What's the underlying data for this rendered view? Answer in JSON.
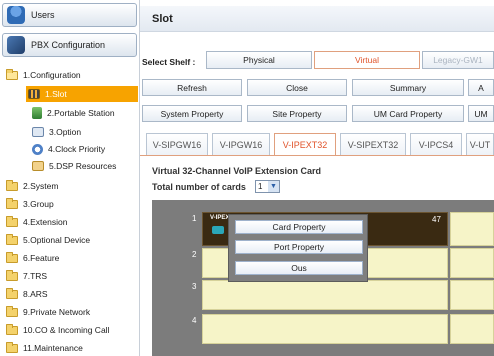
{
  "sidebar": {
    "users_label": "Users",
    "pbx_label": "PBX Configuration",
    "tree": [
      {
        "label": "1.Configuration",
        "icon": "folder-open-icon"
      },
      {
        "label": "1.Slot",
        "icon": "slot-icon",
        "selected": true
      },
      {
        "label": "2.Portable Station",
        "icon": "portable-station-icon"
      },
      {
        "label": "3.Option",
        "icon": "option-icon"
      },
      {
        "label": "4.Clock Priority",
        "icon": "clock-icon"
      },
      {
        "label": "5.DSP Resources",
        "icon": "dsp-icon"
      },
      {
        "label": "2.System",
        "icon": "folder-icon"
      },
      {
        "label": "3.Group",
        "icon": "folder-icon"
      },
      {
        "label": "4.Extension",
        "icon": "folder-icon"
      },
      {
        "label": "5.Optional Device",
        "icon": "folder-icon"
      },
      {
        "label": "6.Feature",
        "icon": "folder-icon"
      },
      {
        "label": "7.TRS",
        "icon": "folder-icon"
      },
      {
        "label": "8.ARS",
        "icon": "folder-icon"
      },
      {
        "label": "9.Private Network",
        "icon": "folder-icon"
      },
      {
        "label": "10.CO & Incoming Call",
        "icon": "folder-icon"
      },
      {
        "label": "11.Maintenance",
        "icon": "folder-icon"
      }
    ]
  },
  "main": {
    "title": "Slot",
    "select_shelf_label": "Select Shelf :",
    "shelf_buttons": [
      "Physical",
      "Virtual",
      "Legacy-GW1"
    ],
    "action_buttons_row1": [
      "Refresh",
      "Close",
      "Summary",
      "A"
    ],
    "action_buttons_row2": [
      "System Property",
      "Site Property",
      "UM Card Property",
      "UM"
    ],
    "tabs": [
      "V-SIPGW16",
      "V-IPGW16",
      "V-IPEXT32",
      "V-SIPEXT32",
      "V-IPCS4",
      "V-UT"
    ],
    "active_tab": "V-IPEXT32",
    "card_description": "Virtual 32-Channel VoIP Extension Card",
    "count_label": "Total number of cards",
    "count_value": "1",
    "rows": [
      "1",
      "2",
      "3",
      "4"
    ],
    "slot_card_label": "V-IPEX",
    "slot_count": "47",
    "popup_items": [
      "Card Property",
      "Port Property",
      "Ous"
    ]
  },
  "colors": {
    "accent": "#e0542b",
    "selected_bg": "#f7a300",
    "slot_bg": "#f6f4c8"
  }
}
